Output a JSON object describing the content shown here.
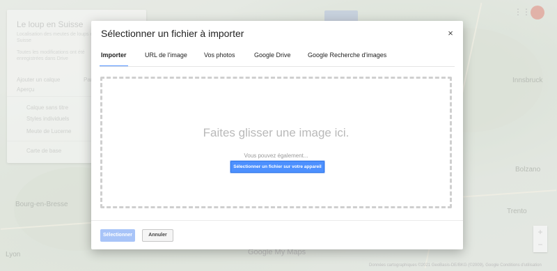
{
  "map": {
    "panel_title": "Le loup en Suisse",
    "panel_line1": "Localisation des meutes de loups en",
    "panel_line2": "Suisse",
    "panel_line3": "Toutes les modifications ont été",
    "panel_line4": "enregistrées dans Drive",
    "add_layer": "Ajouter un calque",
    "share": "Partager",
    "preview": "Aperçu",
    "layer_name": "Calque sans titre",
    "layer_style": "Styles individuels",
    "place_name": "Meute de Lucerne",
    "basemap": "Carte de base",
    "city_innsbruck": "Innsbruck",
    "city_bolzano": "Bolzano",
    "city_lyon": "Lyon",
    "city_trento": "Trento",
    "city_bourg": "Bourg-en-Bresse",
    "google_logo": "Google My Maps",
    "footer": "Données cartographiques ©2021 GeoBasis-DE/BKG (©2009), Google   Conditions d'utilisation"
  },
  "dialog": {
    "title": "Sélectionner un fichier à importer",
    "close": "×",
    "tabs": [
      "Importer",
      "URL de l'image",
      "Vos photos",
      "Google Drive",
      "Google Recherche d'images"
    ],
    "drop_title": "Faites glisser une image ici.",
    "drop_sub": "Vous pouvez également...",
    "pick_button": "Sélectionner un fichier sur votre appareil",
    "select_button": "Sélectionner",
    "cancel_button": "Annuler"
  },
  "colors": {
    "accent": "#4d90fe",
    "disabled_accent": "#a8c4f8"
  }
}
